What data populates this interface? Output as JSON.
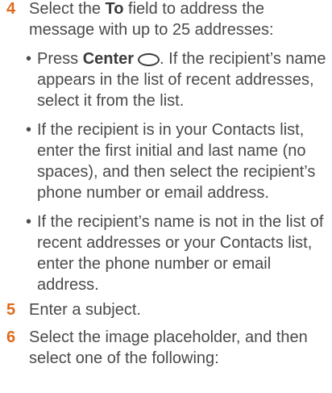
{
  "steps": [
    {
      "number": "4",
      "pre": "Select the ",
      "bold": "To",
      "post": " field to address the message with up to 25 addresses:",
      "bullets": [
        {
          "bold_pre": "Press ",
          "bold": "Center",
          "icon": "center-button-icon",
          "text": ". If the recipient’s name appears in the list of recent addresses, select it from the list."
        },
        {
          "text": "If the recipient is in your Contacts list, enter the first initial and last name (no spaces), and then select the recipient’s phone number or email address."
        },
        {
          "text": "If the recipient’s name is not in the list of recent addresses or your Contacts list, enter the phone number or email address."
        }
      ]
    },
    {
      "number": "5",
      "text": "Enter a subject."
    },
    {
      "number": "6",
      "text": "Select the image placeholder, and then select one of the following:"
    }
  ],
  "colors": {
    "step_number": "#e06a1a",
    "body_text": "#4a4a4a"
  }
}
